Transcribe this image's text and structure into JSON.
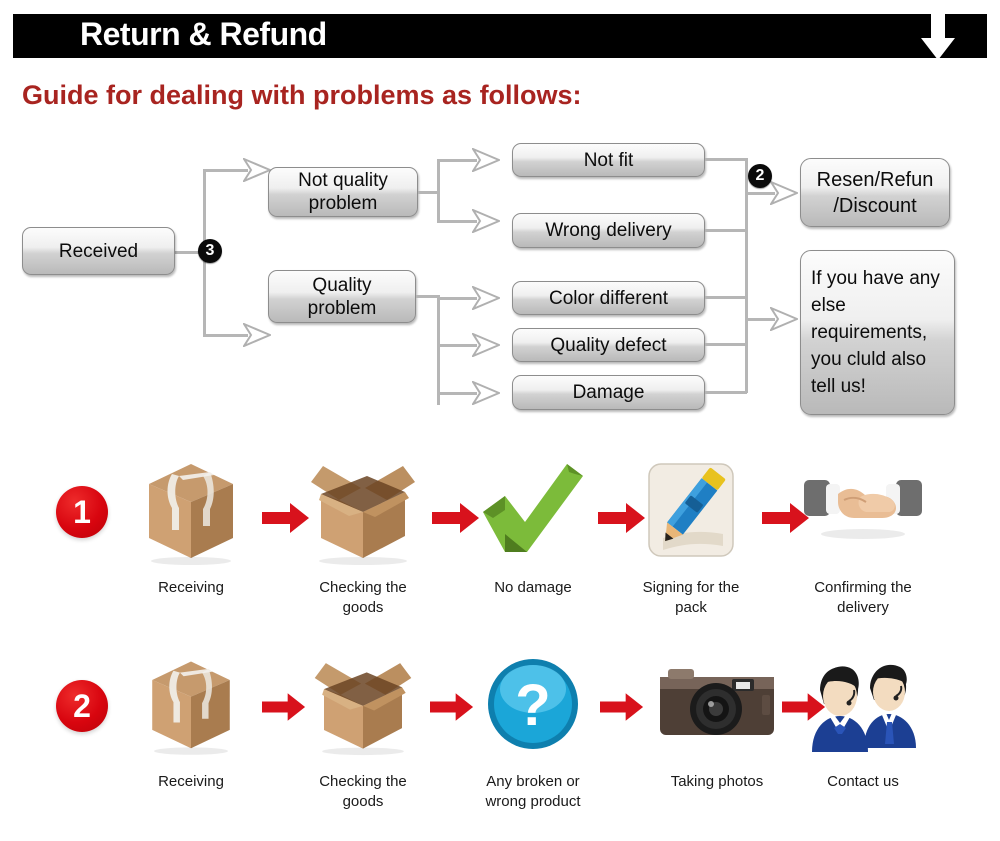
{
  "header": {
    "title": "Return & Refund",
    "arrow_icon": "down-arrow-icon",
    "bar_color": "#000000"
  },
  "guide": {
    "title": "Guide for dealing with problems as follows:",
    "color": "#a82420"
  },
  "flowchart": {
    "start": {
      "label": "Received"
    },
    "badges": [
      {
        "name": "badge-3",
        "value": "3"
      },
      {
        "name": "badge-2",
        "value": "2"
      }
    ],
    "categories": [
      {
        "label": "Not quality\nproblem",
        "line1": "Not quality",
        "line2": "problem"
      },
      {
        "label": "Quality\nproblem",
        "line1": "Quality",
        "line2": "problem"
      }
    ],
    "reasons": [
      {
        "label": "Not fit"
      },
      {
        "label": "Wrong delivery"
      },
      {
        "label": "Color different"
      },
      {
        "label": "Quality defect"
      },
      {
        "label": "Damage"
      }
    ],
    "outcomes": [
      {
        "line1": "Resen/Refun",
        "line2": "/Discount"
      },
      {
        "text": "If you have any else requirements, you cluld also tell us!"
      }
    ],
    "connector_color": "#b6b6b6"
  },
  "process_rows": [
    {
      "number": "1",
      "badge_color": "#d8050f",
      "steps": [
        {
          "icon": "sealed-box-icon",
          "label": "Receiving"
        },
        {
          "icon": "open-box-icon",
          "label": "Checking the goods"
        },
        {
          "icon": "green-check-icon",
          "label": "No damage"
        },
        {
          "icon": "pencil-signing-icon",
          "label": "Signing for the pack"
        },
        {
          "icon": "handshake-icon",
          "label": "Confirming the delivery"
        }
      ]
    },
    {
      "number": "2",
      "badge_color": "#d8050f",
      "steps": [
        {
          "icon": "sealed-box-icon",
          "label": "Receiving"
        },
        {
          "icon": "open-box-icon",
          "label": "Checking the goods"
        },
        {
          "icon": "question-mark-icon",
          "label": "Any broken or wrong product"
        },
        {
          "icon": "camera-icon",
          "label": "Taking photos"
        },
        {
          "icon": "support-agents-icon",
          "label": "Contact us"
        }
      ]
    }
  ],
  "arrow_icon_name": "red-right-arrow-icon"
}
